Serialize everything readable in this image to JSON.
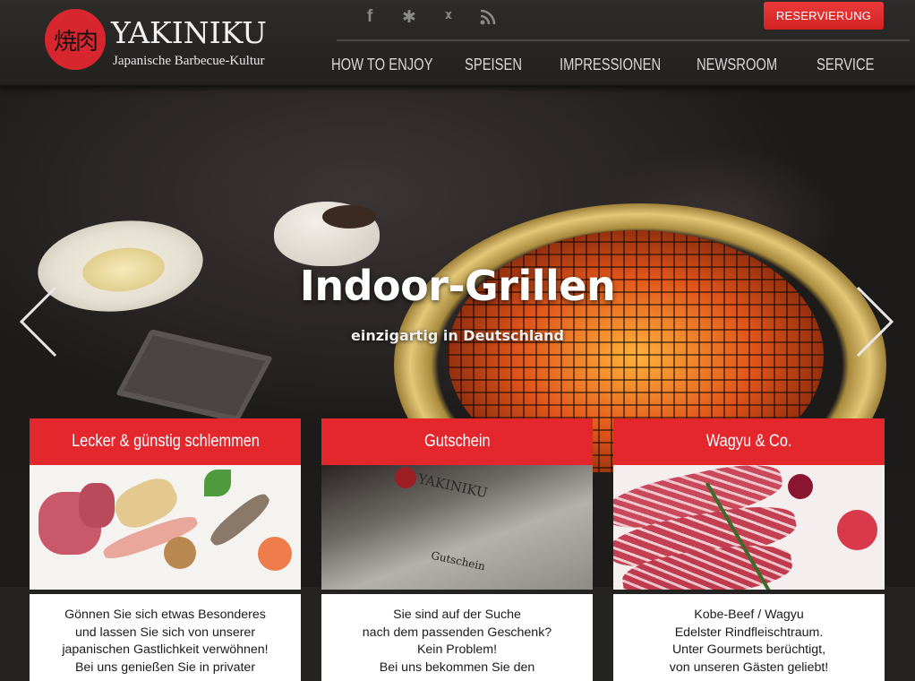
{
  "brand": {
    "seal_text": "焼肉",
    "name": "YAKINIKU",
    "tagline": "Japanische Barbecue-Kultur"
  },
  "social": [
    {
      "icon": "facebook-icon",
      "glyph": "f"
    },
    {
      "icon": "yelp-icon",
      "glyph": "✱"
    },
    {
      "icon": "xing-icon",
      "glyph": "ᵡ"
    },
    {
      "icon": "rss-icon",
      "glyph": "◝"
    }
  ],
  "reserve_button": "RESERVIERUNG",
  "nav": [
    "HOW TO ENJOY",
    "SPEISEN",
    "IMPRESSIONEN",
    "NEWSROOM",
    "SERVICE"
  ],
  "hero": {
    "title": "Indoor-Grillen",
    "subtitle": "einzigartig in Deutschland"
  },
  "cards": [
    {
      "title": "Lecker & günstig schlemmen",
      "lines": [
        "Gönnen Sie sich etwas Besonderes",
        "und lassen Sie sich von unserer",
        "japanischen Gastlichkeit verwöhnen!",
        "Bei uns genießen Sie in privater"
      ]
    },
    {
      "title": "Gutschein",
      "lines": [
        "Sie sind auf der Suche",
        "nach dem passenden Geschenk?",
        "Kein Problem!",
        "Bei uns bekommen Sie den"
      ],
      "image_texts": [
        "YAKINIKU",
        "Gutschein"
      ]
    },
    {
      "title": "Wagyu & Co.",
      "lines": [
        "Kobe-Beef / Wagyu",
        "Edelster Rindfleischtraum.",
        "Unter Gourmets berüchtigt,",
        "von unseren Gästen geliebt!"
      ]
    }
  ],
  "colors": {
    "accent": "#e4262d",
    "header_bg": "#2a2928",
    "nav_text": "#d8d8d8"
  }
}
